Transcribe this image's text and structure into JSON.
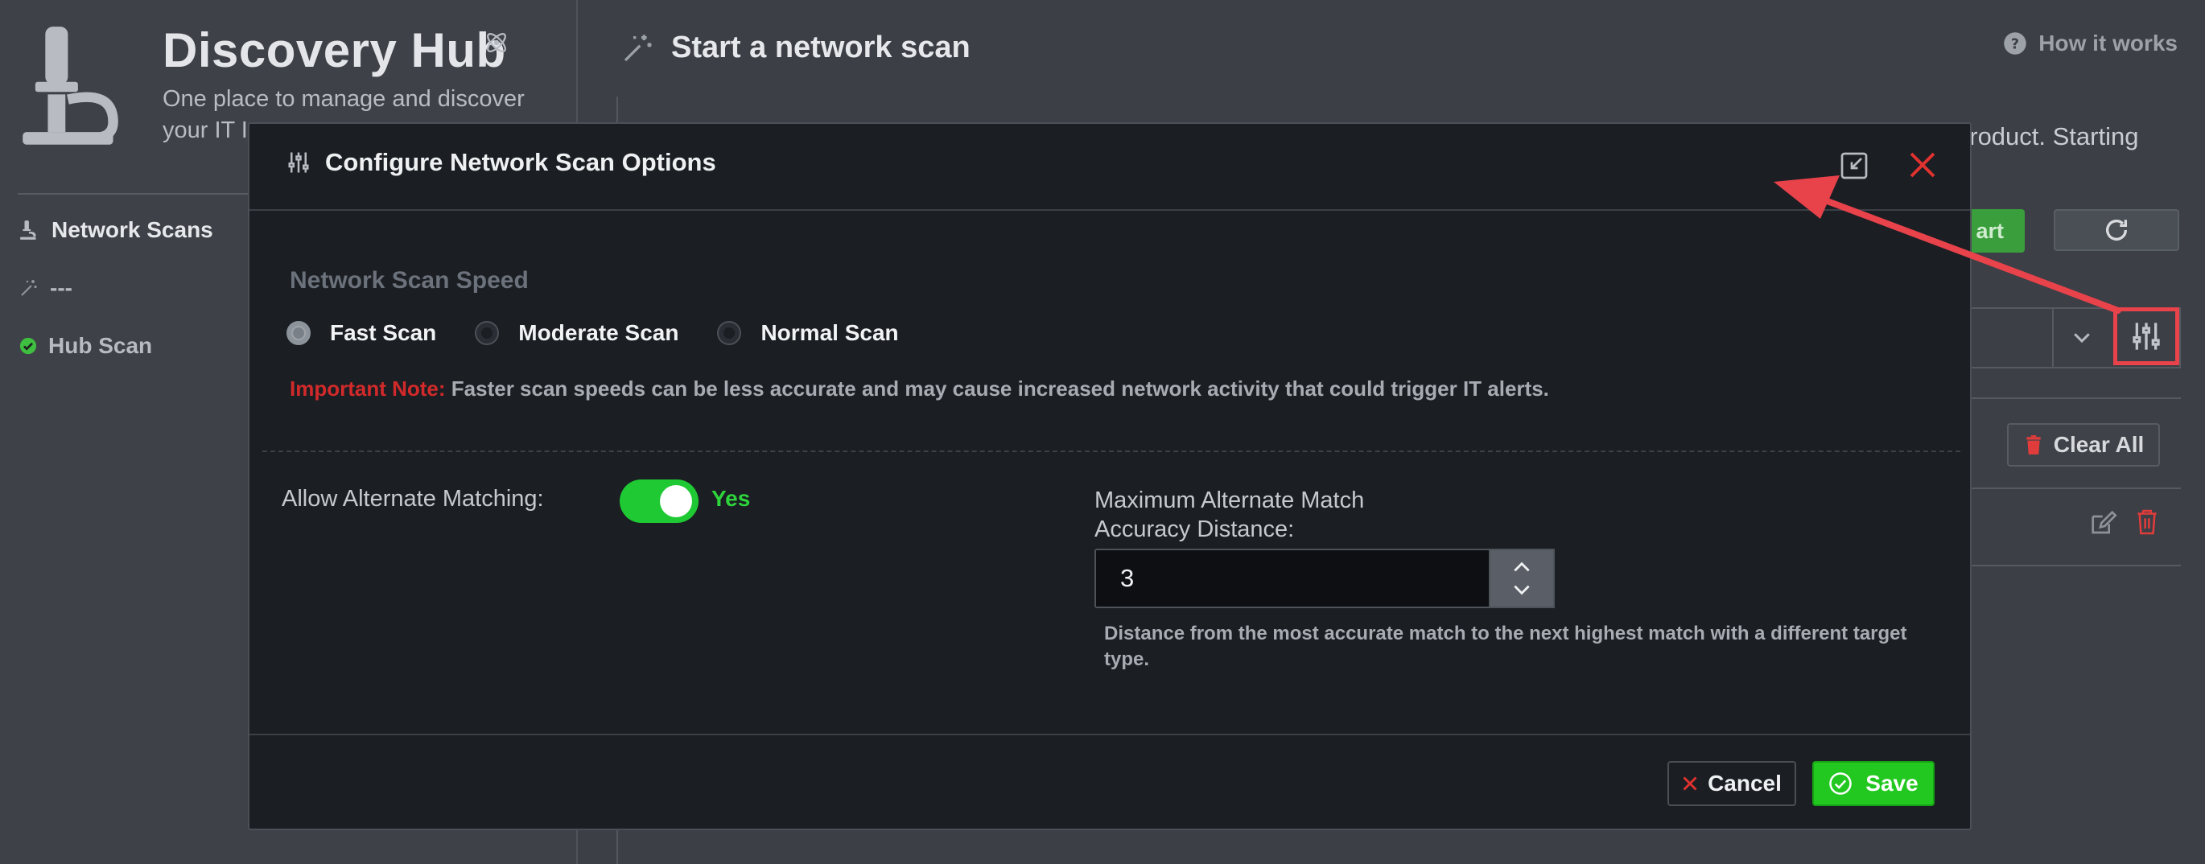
{
  "app": {
    "title": "Discovery Hub",
    "subtitle": "One place to manage and discover your IT In",
    "icon": "microscope-icon"
  },
  "sidebar": {
    "items": [
      {
        "label": "Network Scans",
        "icon": "microscope-icon",
        "active": true
      },
      {
        "label": "---",
        "icon": "magic-wand-icon",
        "active": false
      },
      {
        "label": "Hub Scan",
        "icon": "check-circle-icon",
        "active": false,
        "status_color": "#3fbf3f"
      }
    ]
  },
  "main": {
    "title": "Start a network scan",
    "how_it_works": "How it works",
    "description_fragment": "product. Starting",
    "start_label": "art",
    "clear_all_label": "Clear All"
  },
  "modal": {
    "title": "Configure Network Scan Options",
    "speed_section_title": "Network Scan Speed",
    "speed_options": [
      {
        "label": "Fast Scan",
        "selected": true
      },
      {
        "label": "Moderate Scan",
        "selected": false
      },
      {
        "label": "Normal Scan",
        "selected": false
      }
    ],
    "note_label": "Important Note:",
    "note_text": " Faster scan speeds can be less accurate and may cause increased network activity that could trigger IT alerts.",
    "alt_matching_label": "Allow Alternate Matching:",
    "alt_matching_value": "Yes",
    "alt_matching_enabled": true,
    "distance_label": "Maximum Alternate Match Accuracy Distance:",
    "distance_value": "3",
    "distance_help": "Distance from the most accurate match to the next highest match with a different target type.",
    "cancel_label": "Cancel",
    "save_label": "Save"
  },
  "colors": {
    "accent_green": "#22c81f",
    "danger_red": "#d22a2a",
    "annotation_red": "#e8424b"
  }
}
